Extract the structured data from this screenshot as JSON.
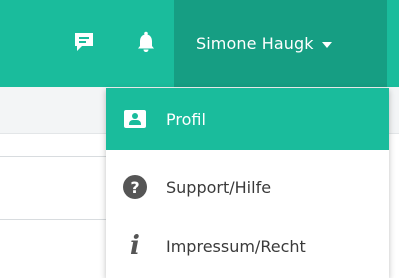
{
  "header": {
    "user_name": "Simone Haugk",
    "icons": {
      "chat": "chat-icon",
      "notifications": "bell-icon",
      "dropdown": "caret-down-icon"
    },
    "colors": {
      "header_bg": "#1abc9c",
      "user_menu_bg": "#169e83"
    }
  },
  "dropdown": {
    "items": [
      {
        "label": "Profil",
        "icon": "profile-card-icon",
        "active": true
      },
      {
        "label": "Support/Hilfe",
        "icon": "question-circle-icon",
        "active": false
      },
      {
        "label": "Impressum/Recht",
        "icon": "info-icon",
        "active": false
      }
    ],
    "colors": {
      "active_bg": "#1abc9c",
      "icon_color": "#555555"
    }
  }
}
